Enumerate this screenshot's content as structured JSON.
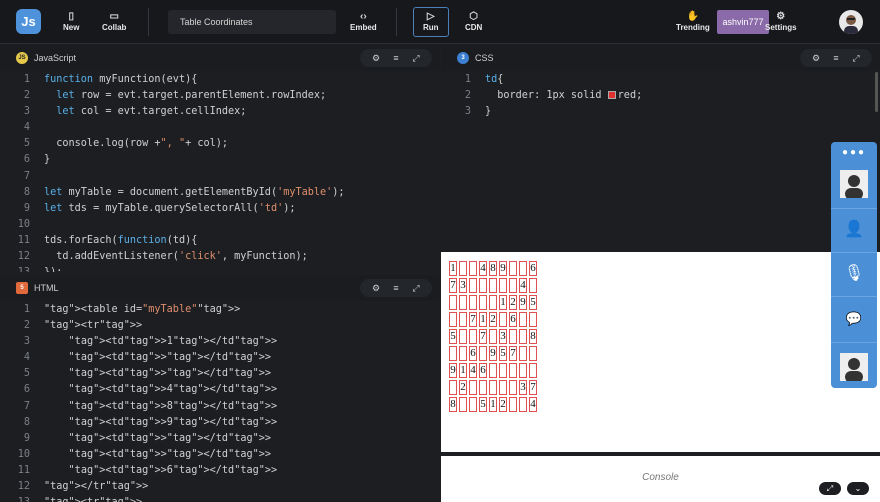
{
  "topbar": {
    "new_label": "New",
    "collab_label": "Collab",
    "title": "Table Coordinates",
    "embed_label": "Embed",
    "run_label": "Run",
    "cdn_label": "CDN",
    "trending_label": "Trending",
    "username": "ashvin777",
    "settings_label": "Settings"
  },
  "js_panel": {
    "title": "JavaScript",
    "badge": "JS",
    "lines": [
      {
        "n": "1",
        "t": "function myFunction(evt){"
      },
      {
        "n": "2",
        "t": "  let row = evt.target.parentElement.rowIndex;"
      },
      {
        "n": "3",
        "t": "  let col = evt.target.cellIndex;"
      },
      {
        "n": "4",
        "t": ""
      },
      {
        "n": "5",
        "t": "  console.log(row +\", \"+ col);"
      },
      {
        "n": "6",
        "t": "}"
      },
      {
        "n": "7",
        "t": ""
      },
      {
        "n": "8",
        "t": "let myTable = document.getElementById('myTable');"
      },
      {
        "n": "9",
        "t": "let tds = myTable.querySelectorAll('td');"
      },
      {
        "n": "10",
        "t": ""
      },
      {
        "n": "11",
        "t": "tds.forEach(function(td){"
      },
      {
        "n": "12",
        "t": "  td.addEventListener('click', myFunction);"
      },
      {
        "n": "13",
        "t": "});"
      }
    ]
  },
  "html_panel": {
    "title": "HTML",
    "badge": "5",
    "lines": [
      {
        "n": "1",
        "t": "<table id=\"myTable\">"
      },
      {
        "n": "2",
        "t": "<tr>"
      },
      {
        "n": "3",
        "t": "    <td>1</td>"
      },
      {
        "n": "4",
        "t": "    <td></td>"
      },
      {
        "n": "5",
        "t": "    <td></td>"
      },
      {
        "n": "6",
        "t": "    <td>4</td>"
      },
      {
        "n": "7",
        "t": "    <td>8</td>"
      },
      {
        "n": "8",
        "t": "    <td>9</td>"
      },
      {
        "n": "9",
        "t": "    <td></td>"
      },
      {
        "n": "10",
        "t": "    <td></td>"
      },
      {
        "n": "11",
        "t": "    <td>6</td>"
      },
      {
        "n": "12",
        "t": "</tr>"
      },
      {
        "n": "13",
        "t": "<tr>"
      }
    ]
  },
  "css_panel": {
    "title": "CSS",
    "badge": "3",
    "lines": [
      {
        "n": "1",
        "t": "td{"
      },
      {
        "n": "2",
        "t": "  border: 1px solid ",
        "color": "red;"
      },
      {
        "n": "3",
        "t": "}"
      }
    ]
  },
  "output_table": [
    [
      "1",
      "",
      "",
      "4",
      "8",
      "9",
      "",
      "",
      "6"
    ],
    [
      "7",
      "3",
      "",
      "",
      "",
      "",
      "",
      "4",
      ""
    ],
    [
      "",
      "",
      "",
      "",
      "",
      "1",
      "2",
      "9",
      "5"
    ],
    [
      "",
      "",
      "7",
      "1",
      "2",
      "",
      "6",
      "",
      ""
    ],
    [
      "5",
      "",
      "",
      "7",
      "",
      "3",
      "",
      "",
      "8"
    ],
    [
      "",
      "",
      "6",
      "",
      "9",
      "5",
      "7",
      "",
      ""
    ],
    [
      "9",
      "1",
      "4",
      "6",
      "",
      "",
      "",
      "",
      ""
    ],
    [
      "",
      "2",
      "",
      "",
      "",
      "",
      "",
      "3",
      "7"
    ],
    [
      "8",
      "",
      "",
      "5",
      "1",
      "2",
      "",
      "",
      "4"
    ]
  ],
  "console": {
    "label": "Console"
  },
  "colors": {
    "accent": "#4b90d6",
    "user_badge": "#8a6aa8",
    "cell_border": "#e05050"
  }
}
